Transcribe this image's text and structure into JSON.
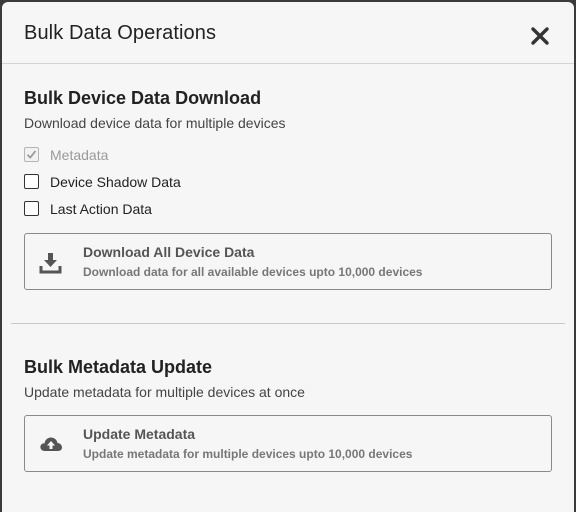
{
  "modal": {
    "title": "Bulk Data Operations",
    "close_icon": "close-icon"
  },
  "download_section": {
    "title": "Bulk Device Data Download",
    "subtitle": "Download device data for multiple devices",
    "options": [
      {
        "label": "Metadata",
        "checked": true,
        "disabled": true
      },
      {
        "label": "Device Shadow Data",
        "checked": false,
        "disabled": false
      },
      {
        "label": "Last Action Data",
        "checked": false,
        "disabled": false
      }
    ],
    "action": {
      "title": "Download All Device Data",
      "description": "Download data for all available devices upto 10,000 devices",
      "icon": "download-icon"
    }
  },
  "metadata_section": {
    "title": "Bulk Metadata Update",
    "subtitle": "Update metadata for multiple devices at once",
    "action": {
      "title": "Update Metadata",
      "description": "Update metadata for multiple devices upto 10,000 devices",
      "icon": "cloud-upload-icon"
    }
  }
}
